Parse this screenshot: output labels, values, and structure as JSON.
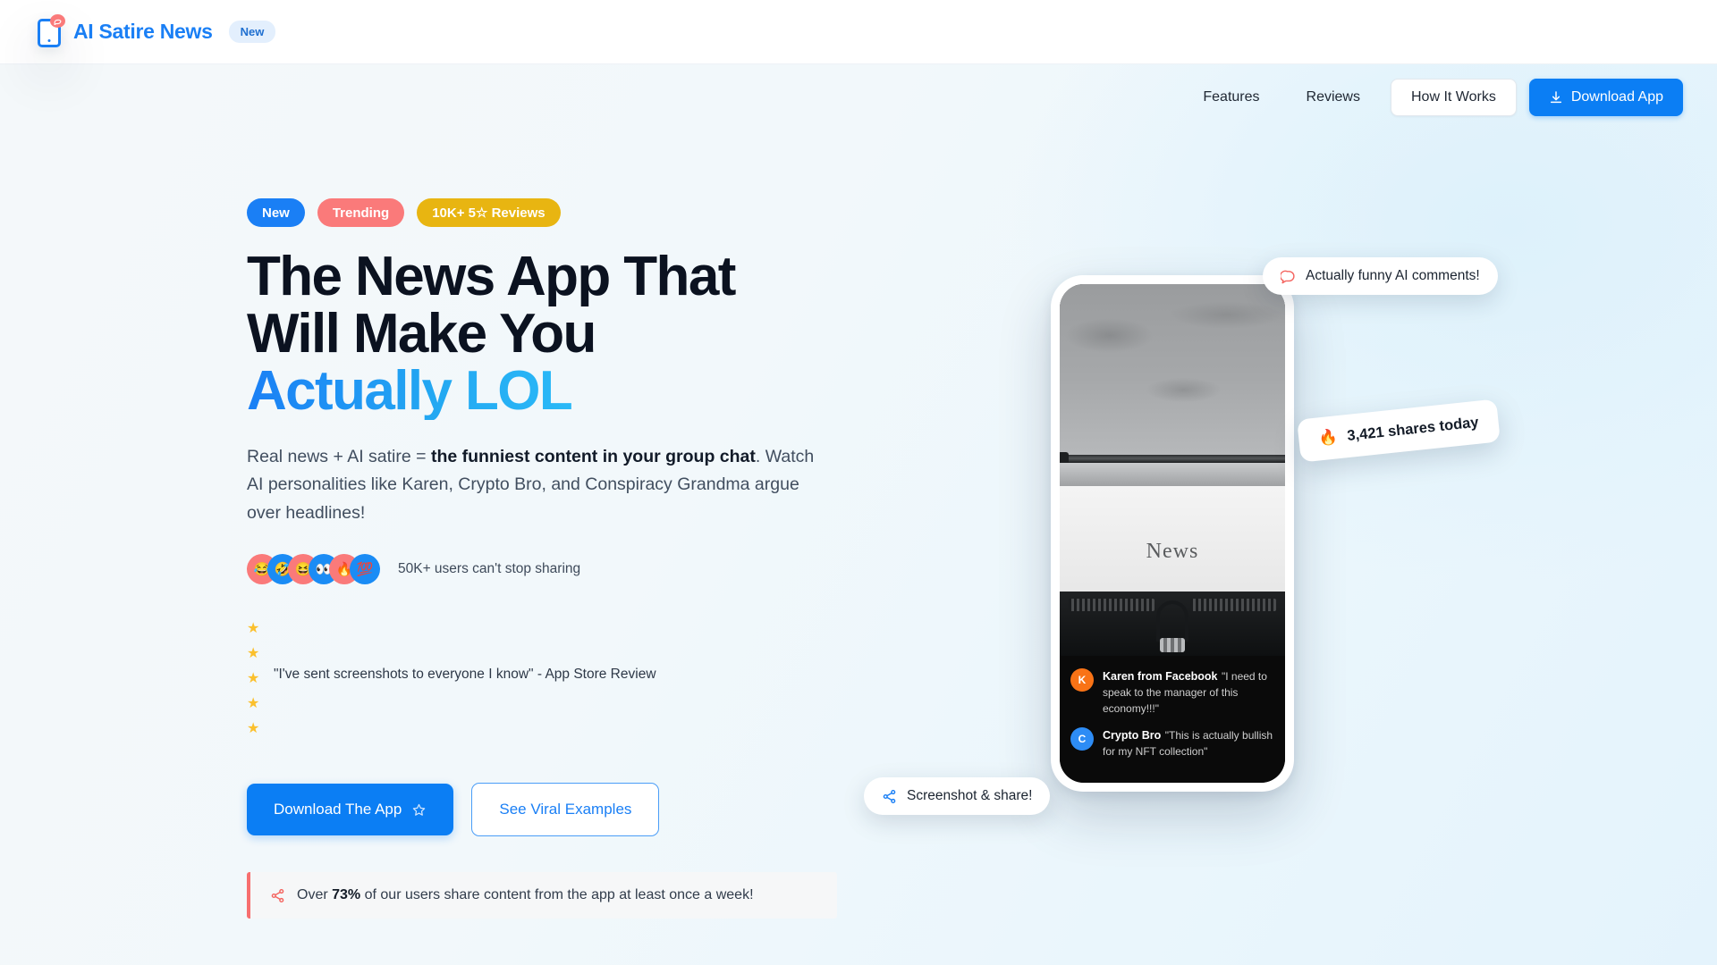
{
  "brand": {
    "name": "AI Satire News",
    "pill": "New",
    "logo_icon": "phone-chat-icon",
    "accent": "#1a7ff5"
  },
  "nav": {
    "links": [
      {
        "label": "Features",
        "name": "nav-features"
      },
      {
        "label": "Reviews",
        "name": "nav-reviews"
      }
    ],
    "how_it_works": "How It Works",
    "download": "Download App",
    "download_icon": "download-icon"
  },
  "hero": {
    "badges": [
      {
        "label": "New",
        "color": "#1a7ff5"
      },
      {
        "label": "Trending",
        "color": "#fa7a7a"
      },
      {
        "label": "10K+ 5☆ Reviews",
        "color": "#e8b511"
      }
    ],
    "headline_line1": "The News App That",
    "headline_line2": "Will Make You",
    "headline_accent": "Actually LOL",
    "sub_part1": "Real news + AI satire = ",
    "sub_bold1": "the funniest content in your group chat",
    "sub_part2": ". Watch AI personalities like Karen, Crypto Bro, and Conspiracy Grandma argue over headlines!",
    "avatars": [
      {
        "emoji": "😂",
        "color": "#fa7a7a"
      },
      {
        "emoji": "🤣",
        "color": "#1a8cf5"
      },
      {
        "emoji": "😆",
        "color": "#fa7a7a"
      },
      {
        "emoji": "👀",
        "color": "#1a8cf5"
      },
      {
        "emoji": "🔥",
        "color": "#fa7a7a"
      },
      {
        "emoji": "💯",
        "color": "#1a8cf5"
      }
    ],
    "proof_text": "50K+ users can't stop sharing",
    "stars": [
      "★",
      "★",
      "★",
      "★",
      "★"
    ],
    "star_color": "#fbc02d",
    "review_quote": "\"I've sent screenshots to everyone I know\" - App Store Review",
    "cta_primary": "Download The App",
    "cta_primary_icon": "star-outline-icon",
    "cta_secondary": "See Viral Examples",
    "stat_icon": "share-icon",
    "stat_prefix": "Over ",
    "stat_value": "73%",
    "stat_suffix": " of our users share content from the app at least once a week!"
  },
  "phone": {
    "photo_word": "News",
    "photo_alt": "typewriter-photo",
    "comments": [
      {
        "initial": "K",
        "avatar_color": "#f97316",
        "name": "Karen from Facebook",
        "text": "\"I need to speak to the manager of this economy!!!\""
      },
      {
        "initial": "C",
        "avatar_color": "#2d8cf5",
        "name": "Crypto Bro",
        "text": "\"This is actually bullish for my NFT collection\""
      }
    ]
  },
  "floating": {
    "comments_pill": "Actually funny AI comments!",
    "comments_icon": "chat-bubble-icon",
    "shares_emoji": "🔥",
    "shares_text": "3,421 shares today",
    "screenshot_pill": "Screenshot & share!",
    "screenshot_icon": "share-icon"
  }
}
